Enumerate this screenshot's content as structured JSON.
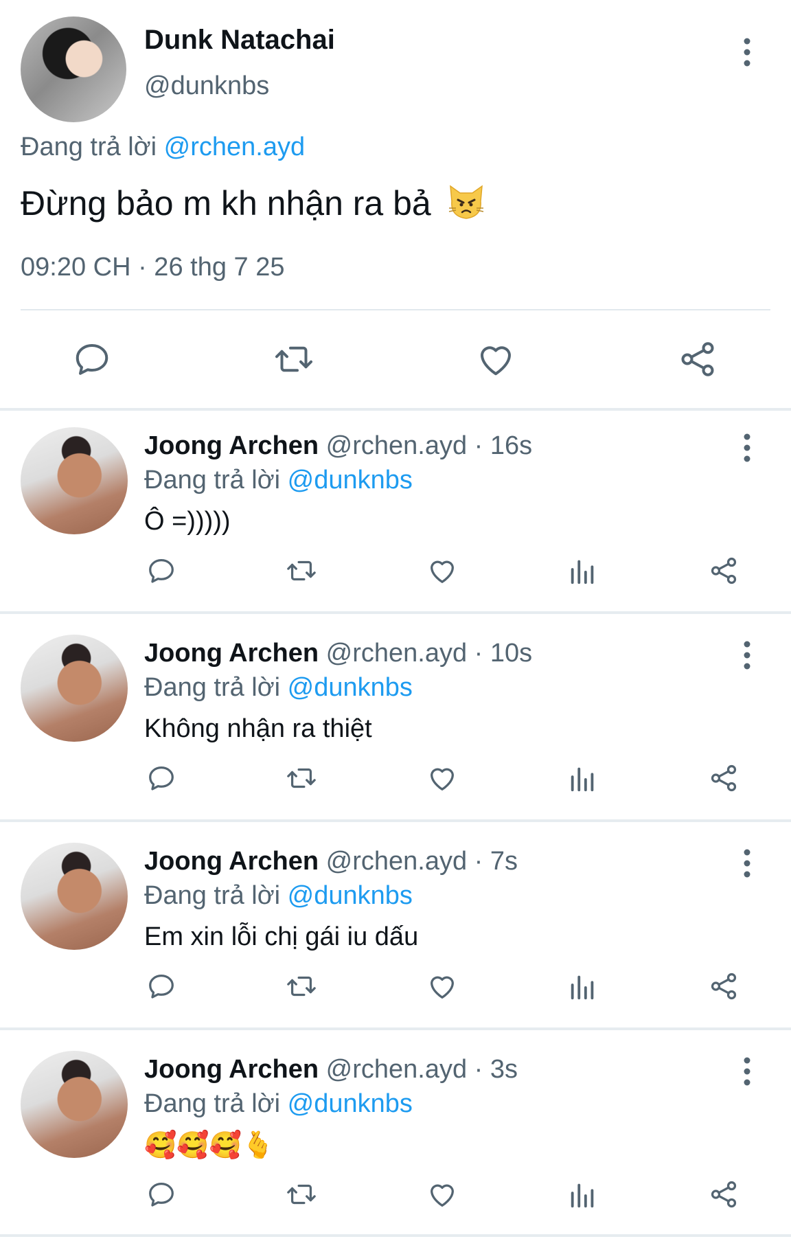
{
  "main_tweet": {
    "author_name": "Dunk Natachai",
    "author_handle": "@dunknbs",
    "replying_prefix": "Đang trả lời",
    "replying_to": "@rchen.ayd",
    "text": "Đừng bảo m kh nhận ra bả",
    "emoji": "pouting-cat-emoji",
    "timestamp": "09:20 CH · 26 thg 7 25",
    "actions": [
      "reply-icon",
      "retweet-icon",
      "like-icon",
      "share-icon"
    ]
  },
  "replies": [
    {
      "author_name": "Joong Archen",
      "author_handle": "@rchen.ayd",
      "separator": "·",
      "time": "16s",
      "replying_prefix": "Đang trả lời",
      "replying_to": "@dunknbs",
      "text": "Ô =)))))"
    },
    {
      "author_name": "Joong Archen",
      "author_handle": "@rchen.ayd",
      "separator": "·",
      "time": "10s",
      "replying_prefix": "Đang trả lời",
      "replying_to": "@dunknbs",
      "text": "Không nhận ra thiệt"
    },
    {
      "author_name": "Joong Archen",
      "author_handle": "@rchen.ayd",
      "separator": "·",
      "time": "7s",
      "replying_prefix": "Đang trả lời",
      "replying_to": "@dunknbs",
      "text": "Em xin lỗi chị gái iu dấu"
    },
    {
      "author_name": "Joong Archen",
      "author_handle": "@rchen.ayd",
      "separator": "·",
      "time": "3s",
      "replying_prefix": "Đang trả lời",
      "replying_to": "@dunknbs",
      "text": "🥰🥰🥰🫰"
    }
  ],
  "colors": {
    "accent": "#1d9bf0",
    "secondary_text": "#536471",
    "primary_text": "#0f1419",
    "separator": "#e6ecf0"
  }
}
